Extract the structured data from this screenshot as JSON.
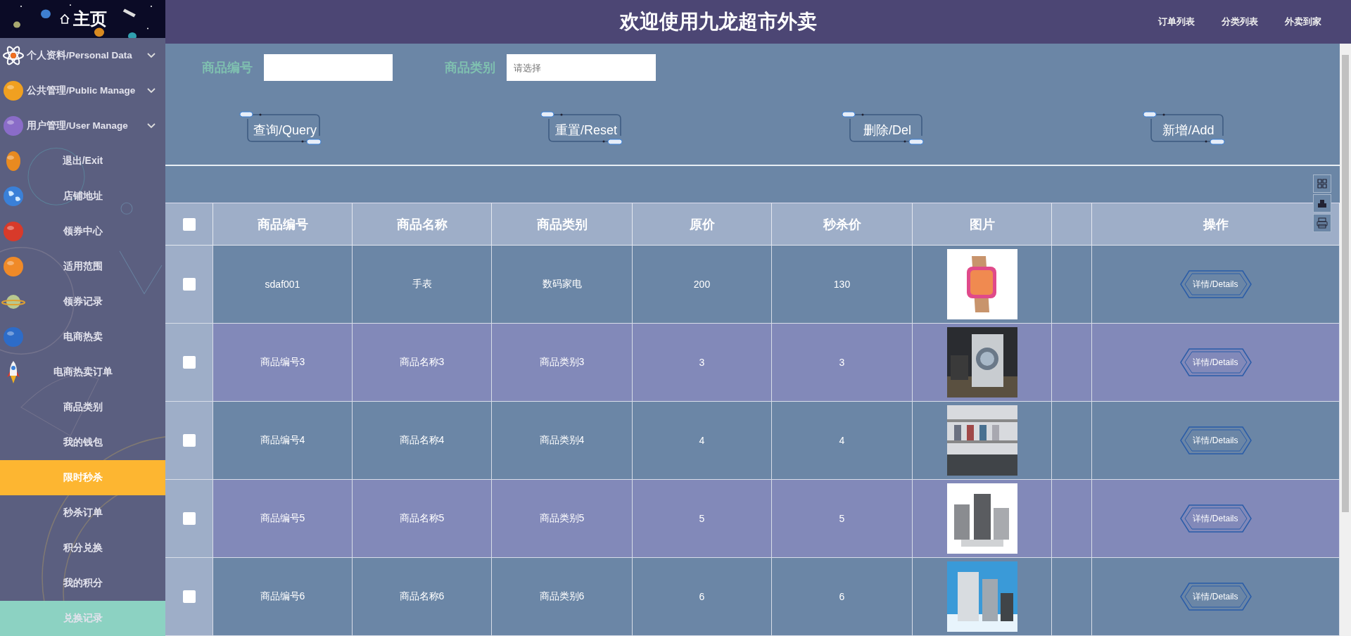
{
  "sidebar": {
    "home": "主页",
    "items": [
      {
        "kind": "group",
        "label": "个人资料/Personal Data",
        "expanded": false,
        "selected": false,
        "hovered": false
      },
      {
        "kind": "group",
        "label": "公共管理/Public Manage",
        "expanded": false,
        "selected": false,
        "hovered": false
      },
      {
        "kind": "group",
        "label": "用户管理/User Manage",
        "expanded": false,
        "selected": false,
        "hovered": false
      },
      {
        "kind": "link",
        "label": "退出/Exit",
        "selected": false,
        "hovered": false
      },
      {
        "kind": "link",
        "label": "店铺地址",
        "selected": false,
        "hovered": false
      },
      {
        "kind": "link",
        "label": "领券中心",
        "selected": false,
        "hovered": false
      },
      {
        "kind": "link",
        "label": "适用范围",
        "selected": false,
        "hovered": false
      },
      {
        "kind": "link",
        "label": "领券记录",
        "selected": false,
        "hovered": false
      },
      {
        "kind": "link",
        "label": "电商热卖",
        "selected": false,
        "hovered": false
      },
      {
        "kind": "link",
        "label": "电商热卖订单",
        "selected": false,
        "hovered": false
      },
      {
        "kind": "link",
        "label": "商品类别",
        "selected": false,
        "hovered": false
      },
      {
        "kind": "link",
        "label": "我的钱包",
        "selected": false,
        "hovered": false
      },
      {
        "kind": "link",
        "label": "限时秒杀",
        "selected": true,
        "hovered": false
      },
      {
        "kind": "link",
        "label": "秒杀订单",
        "selected": false,
        "hovered": false
      },
      {
        "kind": "link",
        "label": "积分兑换",
        "selected": false,
        "hovered": false
      },
      {
        "kind": "link",
        "label": "我的积分",
        "selected": false,
        "hovered": false
      },
      {
        "kind": "link",
        "label": "兑换记录",
        "selected": false,
        "hovered": true
      }
    ]
  },
  "header": {
    "title": "欢迎使用九龙超市外卖",
    "nav": [
      "订单列表",
      "分类列表",
      "外卖到家"
    ]
  },
  "search": {
    "fields": [
      {
        "label": "商品编号"
      },
      {
        "label": "商品类别",
        "placeholder": "请选择"
      }
    ]
  },
  "buttons": [
    "查询/Query",
    "重置/Reset",
    "删除/Del",
    "新增/Add"
  ],
  "table": {
    "select_all_checked": false,
    "columns": [
      "商品编号",
      "商品名称",
      "商品类别",
      "原价",
      "秒杀价",
      "图片",
      "操作"
    ],
    "rows": [
      {
        "checked": false,
        "code": "sdaf001",
        "name": "手表",
        "category": "数码家电",
        "price": "200",
        "sale_price": "130",
        "action": "详情/Details"
      },
      {
        "checked": false,
        "code": "商品编号3",
        "name": "商品名称3",
        "category": "商品类别3",
        "price": "3",
        "sale_price": "3",
        "action": "详情/Details"
      },
      {
        "checked": false,
        "code": "商品编号4",
        "name": "商品名称4",
        "category": "商品类别4",
        "price": "4",
        "sale_price": "4",
        "action": "详情/Details"
      },
      {
        "checked": false,
        "code": "商品编号5",
        "name": "商品名称5",
        "category": "商品类别5",
        "price": "5",
        "sale_price": "5",
        "action": "详情/Details"
      },
      {
        "checked": false,
        "code": "商品编号6",
        "name": "商品名称6",
        "category": "商品类别6",
        "price": "6",
        "sale_price": "6",
        "action": "详情/Details"
      }
    ]
  }
}
